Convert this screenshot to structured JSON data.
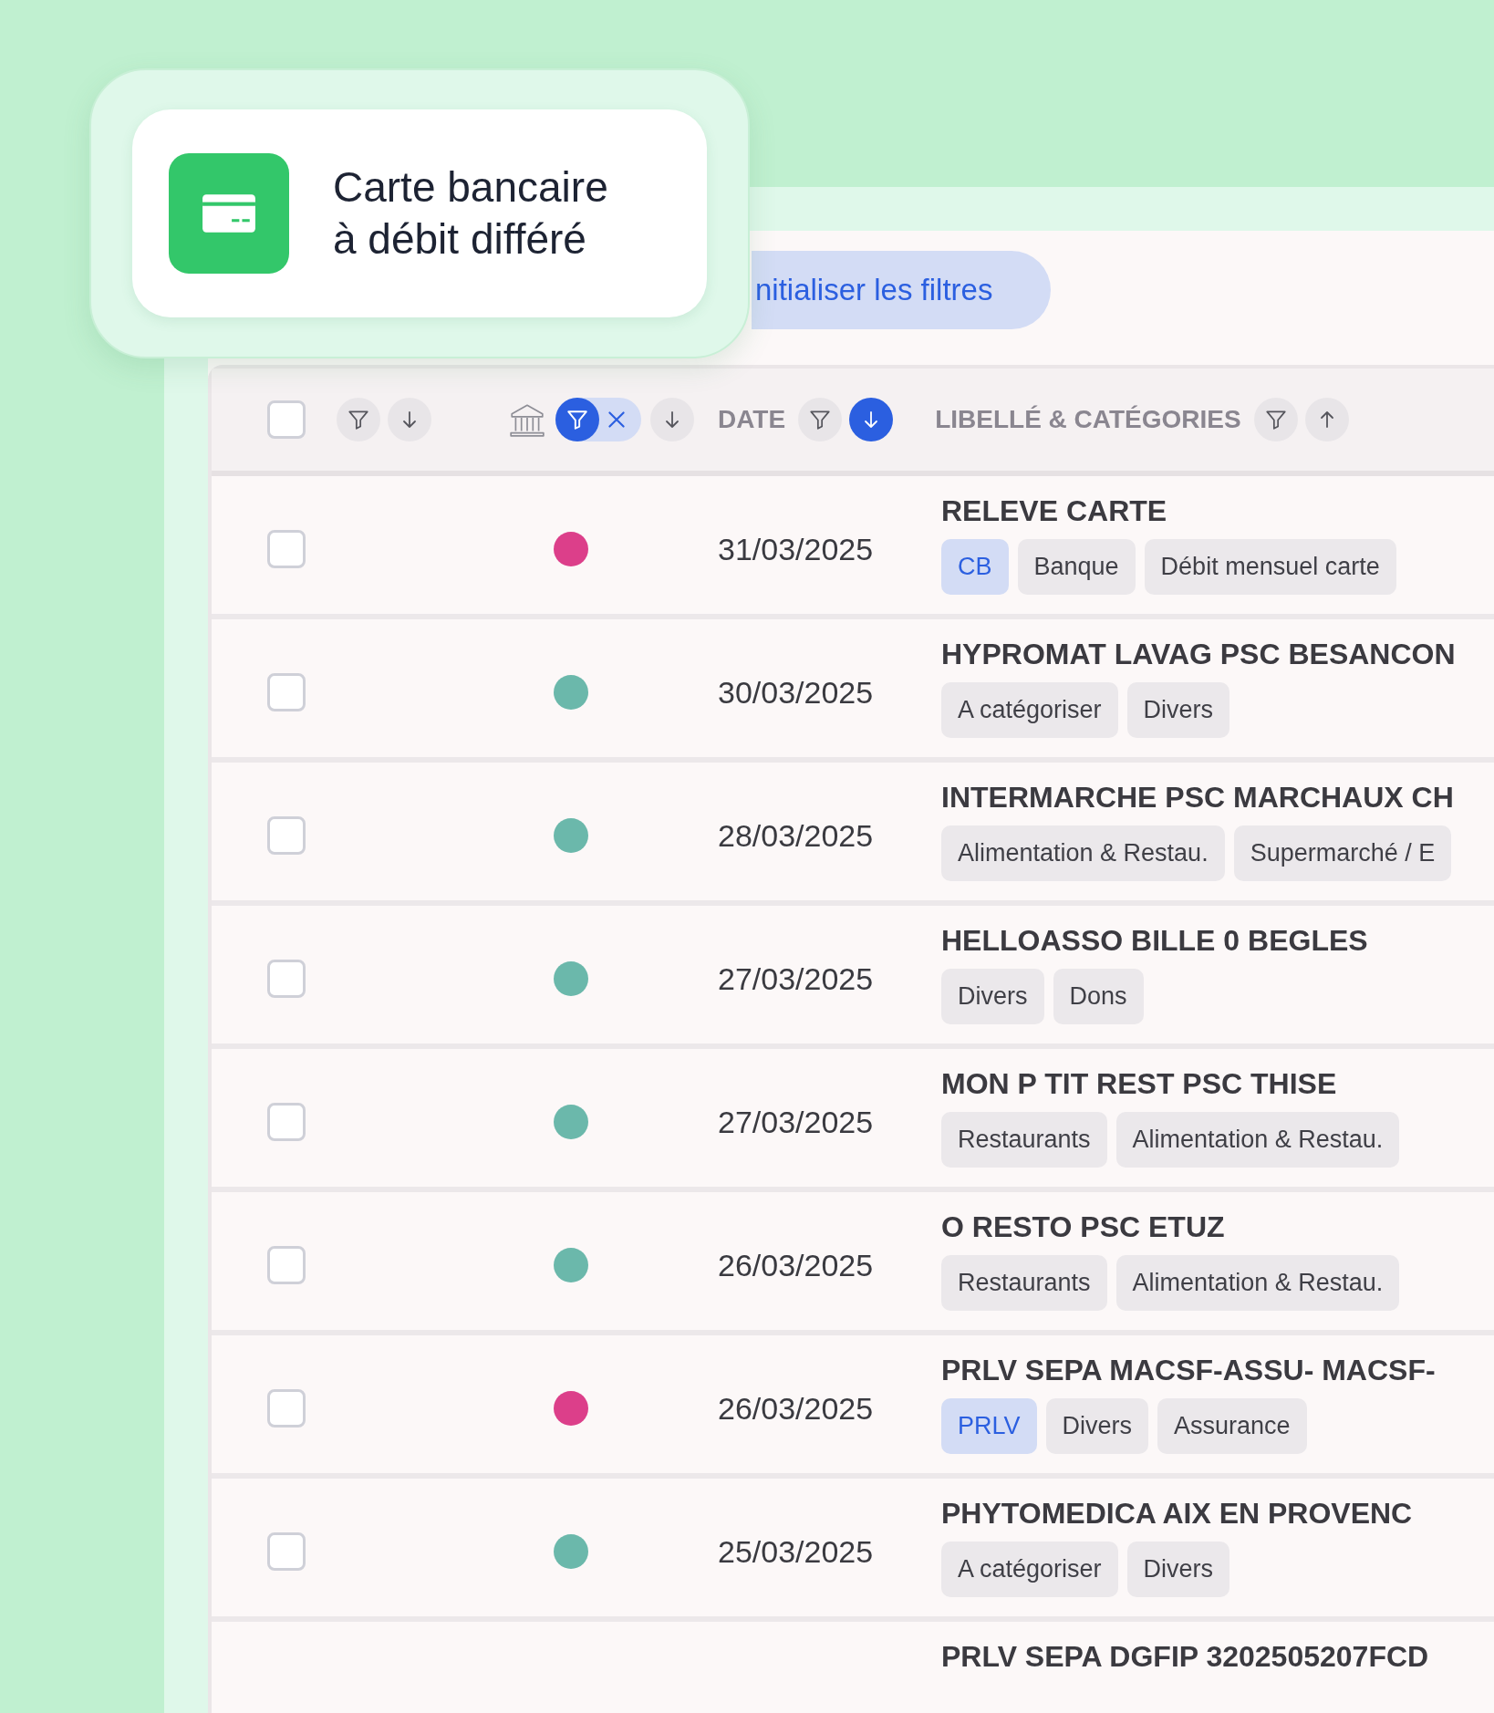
{
  "card": {
    "title": "Carte bancaire à débit différé"
  },
  "toolbar": {
    "reset_button": "nitialiser les filtres"
  },
  "header": {
    "columns": [
      {
        "kind": "select",
        "checked": false
      },
      {
        "kind": "plain",
        "filter_active": false,
        "sort_ascending": false,
        "sort_active": false
      },
      {
        "kind": "account",
        "filter_active": true,
        "sort_ascending": false,
        "sort_active": false
      },
      {
        "kind": "labeled",
        "label": "DATE",
        "filter_active": false,
        "sort_ascending": false,
        "sort_active": true
      },
      {
        "kind": "labeled",
        "label": "LIBELLÉ & CATÉGORIES",
        "filter_active": false,
        "sort_ascending": true,
        "sort_active": false
      }
    ]
  },
  "rows": [
    {
      "checked": false,
      "color": "#dc3f8a",
      "date": "31/03/2025",
      "title": "RELEVE CARTE",
      "tags": [
        {
          "kind": "type",
          "label": "CB"
        },
        {
          "kind": "category",
          "label": "Banque"
        },
        {
          "kind": "category",
          "label": "Débit mensuel carte"
        }
      ]
    },
    {
      "checked": false,
      "color": "#6bb8ab",
      "date": "30/03/2025",
      "title": "HYPROMAT LAVAG PSC BESANCON",
      "tags": [
        {
          "kind": "category",
          "label": "A catégoriser"
        },
        {
          "kind": "category",
          "label": "Divers"
        }
      ]
    },
    {
      "checked": false,
      "color": "#6bb8ab",
      "date": "28/03/2025",
      "title": "INTERMARCHE PSC MARCHAUX CH",
      "tags": [
        {
          "kind": "category",
          "label": "Alimentation & Restau."
        },
        {
          "kind": "category",
          "label": "Supermarché / E"
        }
      ]
    },
    {
      "checked": false,
      "color": "#6bb8ab",
      "date": "27/03/2025",
      "title": "HELLOASSO BILLE 0 BEGLES",
      "tags": [
        {
          "kind": "category",
          "label": "Divers"
        },
        {
          "kind": "category",
          "label": "Dons"
        }
      ]
    },
    {
      "checked": false,
      "color": "#6bb8ab",
      "date": "27/03/2025",
      "title": "MON P TIT REST PSC THISE",
      "tags": [
        {
          "kind": "category",
          "label": "Restaurants"
        },
        {
          "kind": "category",
          "label": "Alimentation & Restau."
        }
      ]
    },
    {
      "checked": false,
      "color": "#6bb8ab",
      "date": "26/03/2025",
      "title": "O RESTO PSC ETUZ",
      "tags": [
        {
          "kind": "category",
          "label": "Restaurants"
        },
        {
          "kind": "category",
          "label": "Alimentation & Restau."
        }
      ]
    },
    {
      "checked": false,
      "color": "#dc3f8a",
      "date": "26/03/2025",
      "title": "PRLV SEPA MACSF-ASSU- MACSF-",
      "tags": [
        {
          "kind": "type",
          "label": "PRLV"
        },
        {
          "kind": "category",
          "label": "Divers"
        },
        {
          "kind": "category",
          "label": "Assurance"
        }
      ]
    },
    {
      "checked": false,
      "color": "#6bb8ab",
      "date": "25/03/2025",
      "title": "PHYTOMEDICA AIX EN PROVENC",
      "tags": [
        {
          "kind": "category",
          "label": "A catégoriser"
        },
        {
          "kind": "category",
          "label": "Divers"
        }
      ]
    },
    {
      "title": "PRLV SEPA DGFIP 3202505207FCD",
      "tags": []
    }
  ]
}
